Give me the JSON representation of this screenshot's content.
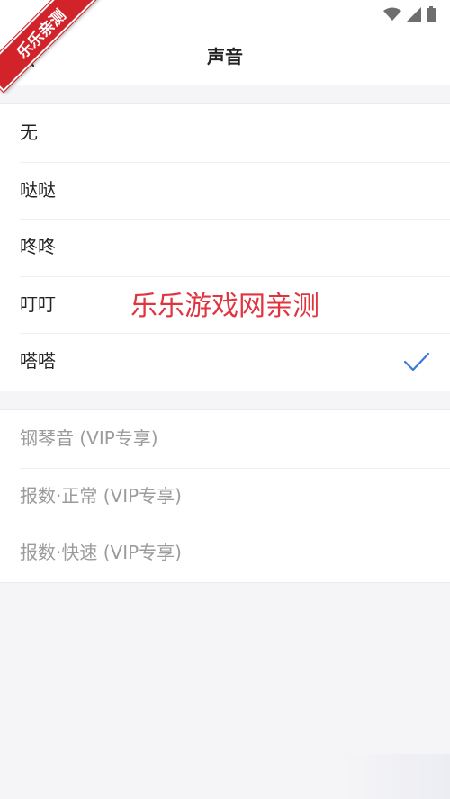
{
  "header": {
    "title": "声音"
  },
  "sounds": [
    {
      "label": "无",
      "selected": false
    },
    {
      "label": "哒哒",
      "selected": false
    },
    {
      "label": "咚咚",
      "selected": false
    },
    {
      "label": "叮叮",
      "selected": false
    },
    {
      "label": "嗒嗒",
      "selected": true
    }
  ],
  "vip_sounds": [
    {
      "label": "钢琴音 (VIP专享)"
    },
    {
      "label": "报数·正常 (VIP专享)"
    },
    {
      "label": "报数·快速 (VIP专享)"
    }
  ],
  "watermarks": {
    "corner": "乐乐亲测",
    "center": "乐乐游戏网亲测"
  },
  "colors": {
    "accent": "#3a7bd5",
    "watermark": "#e0343f",
    "ribbon": "#d2232a",
    "vip_text": "#9b9b9b"
  },
  "icons": {
    "back": "back-arrow-icon",
    "check": "check-icon",
    "wifi": "wifi-icon",
    "signal": "signal-icon",
    "battery": "battery-icon"
  }
}
